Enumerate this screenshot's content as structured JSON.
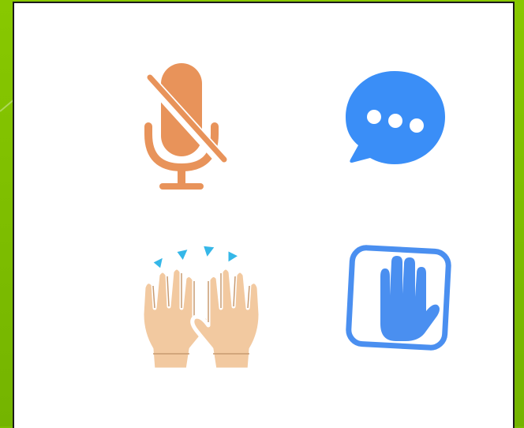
{
  "icons": [
    {
      "name": "muted-microphone-icon",
      "color": "#e8935a"
    },
    {
      "name": "chat-bubble-icon",
      "color": "#3a8ef7"
    },
    {
      "name": "raising-hands-emoji-icon",
      "color": "#f2c9a0"
    },
    {
      "name": "raise-hand-icon",
      "color": "#4a8ff0"
    }
  ],
  "colors": {
    "background": "#7cbf00",
    "card": "#ffffff",
    "border": "#1a1a1a"
  }
}
